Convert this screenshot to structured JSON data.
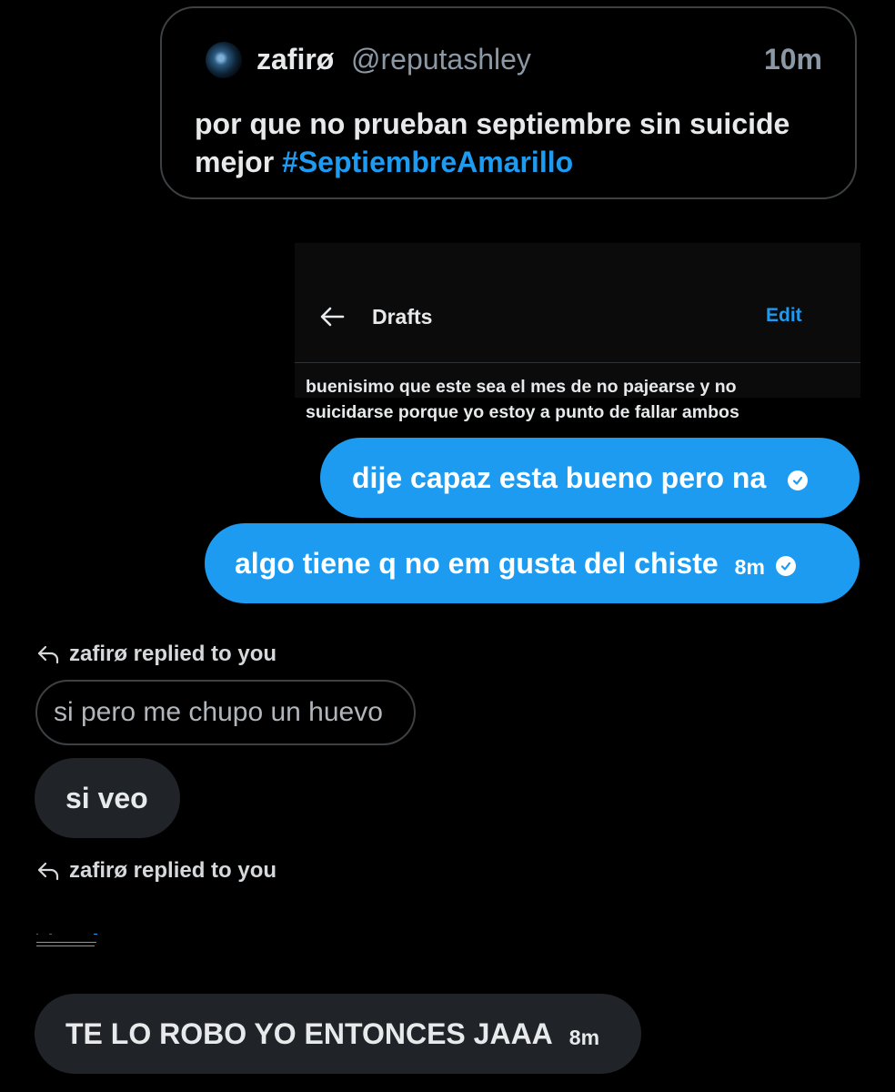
{
  "quoted_tweet": {
    "name": "zafirø",
    "handle": "@reputashley",
    "time": "10m",
    "text_plain": "por que no prueban septiembre sin suicide mejor ",
    "hashtag": "#SeptiembreAmarillo"
  },
  "drafts_screenshot": {
    "title": "Drafts",
    "edit_label": "Edit",
    "draft_text": "buenisimo que este sea el mes de no pajearse y no suicidarse porque yo estoy a punto de fallar ambos"
  },
  "sent_messages": [
    {
      "text": "dije capaz esta bueno pero na",
      "time": ""
    },
    {
      "text": "algo tiene q no em gusta del chiste",
      "time": "8m"
    }
  ],
  "replies": [
    {
      "indicator": "zafirø replied to you",
      "quoted": "si pero me chupo un huevo",
      "text": "si veo"
    },
    {
      "indicator": "zafirø replied to you",
      "text": "TE LO ROBO YO ENTONCES JAAA",
      "time": "8m"
    }
  ],
  "colors": {
    "background": "#000000",
    "accent": "#1d9bf0",
    "incoming_bubble": "#202327",
    "border": "#3e4144"
  }
}
